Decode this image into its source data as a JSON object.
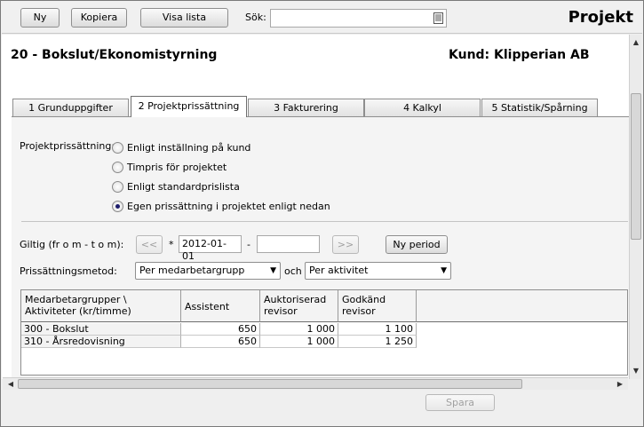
{
  "toolbar": {
    "new_label": "Ny",
    "copy_label": "Kopiera",
    "show_list_label": "Visa lista",
    "search_label": "Sök:",
    "search_value": "",
    "app_title": "Projekt"
  },
  "project": {
    "title": "20 - Bokslut/Ekonomistyrning",
    "customer": "Kund: Klipperian AB"
  },
  "tabs": [
    {
      "label": "1 Grunduppgifter",
      "active": false
    },
    {
      "label": "2 Projektprissättning",
      "active": true
    },
    {
      "label": "3 Fakturering",
      "active": false
    },
    {
      "label": "4 Kalkyl",
      "active": false
    },
    {
      "label": "5 Statistik/Spårning",
      "active": false
    }
  ],
  "pricing": {
    "label": "Projektprissättning:",
    "options": [
      {
        "label": "Enligt inställning på kund",
        "selected": false
      },
      {
        "label": "Timpris för projektet",
        "selected": false
      },
      {
        "label": "Enligt standardprislista",
        "selected": false
      },
      {
        "label": "Egen prissättning i projektet enligt nedan",
        "selected": true
      }
    ]
  },
  "validity": {
    "label": "Giltig (fr o m - t o m):",
    "prev_label": "<<",
    "asterisk": "*",
    "from_value": "2012-01-01",
    "dash": "-",
    "to_value": "",
    "next_label": ">>",
    "new_period_label": "Ny period"
  },
  "method": {
    "label": "Prissättningsmetod:",
    "first_value": "Per medarbetargrupp",
    "conjunction": "och",
    "second_value": "Per aktivitet"
  },
  "grid": {
    "corner_header": "Medarbetargrupper \\ Aktiviteter (kr/timme)",
    "columns": [
      "Assistent",
      "Auktoriserad revisor",
      "Godkänd revisor"
    ],
    "rows": [
      {
        "name": "300 - Bokslut",
        "values": [
          "650",
          "1 000",
          "1 100"
        ]
      },
      {
        "name": "310 - Årsredovisning",
        "values": [
          "650",
          "1 000",
          "1 250"
        ]
      }
    ]
  },
  "footer": {
    "save_label": "Spara"
  }
}
